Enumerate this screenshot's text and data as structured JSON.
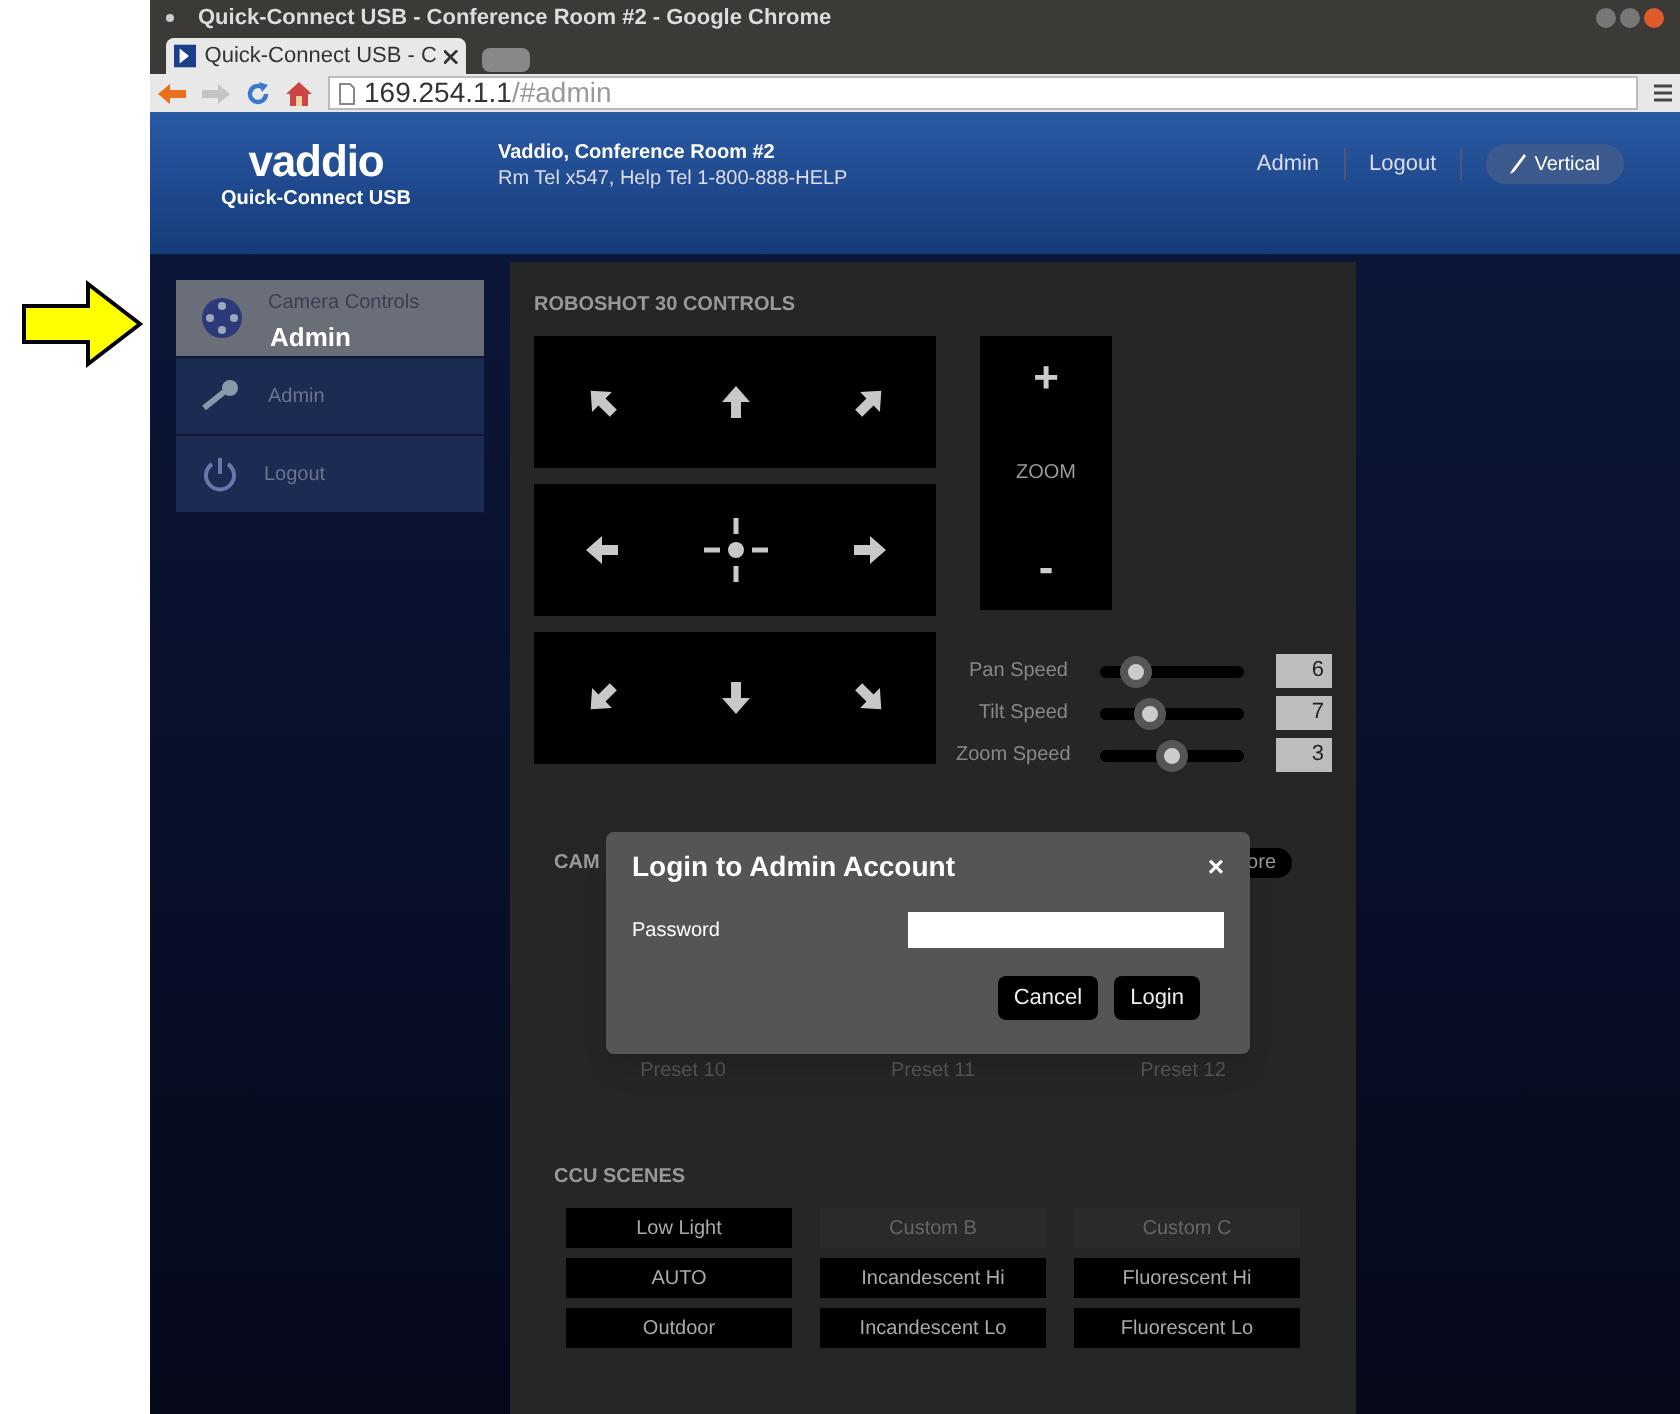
{
  "annotation": {
    "label": "Admin"
  },
  "window": {
    "title": "Quick-Connect USB - Conference Room #2 - Google Chrome"
  },
  "tabs": [
    {
      "label": "Quick-Connect USB - C",
      "selected": true
    }
  ],
  "address_bar": {
    "host": "169.254.1.1",
    "path": "/#admin"
  },
  "header": {
    "logo": "vaddio",
    "product": "Quick-Connect USB",
    "room": "Vaddio, Conference Room #2",
    "phone": "Rm Tel x547, Help Tel 1-800-888-HELP",
    "links": [
      "Admin",
      "Logout"
    ],
    "view_button": "Vertical"
  },
  "sidebar": {
    "items": [
      {
        "label": "Camera Controls",
        "selected": true
      },
      {
        "label": "Admin",
        "selected": false
      },
      {
        "label": "Logout",
        "selected": false
      }
    ]
  },
  "controls": {
    "title": "ROBOSHOT 30 CONTROLS",
    "zoom_label": "ZOOM",
    "zoom_in": "+",
    "zoom_out": "-",
    "speeds": [
      {
        "label": "Pan Speed",
        "level": 0.25,
        "value": "6"
      },
      {
        "label": "Tilt Speed",
        "level": 0.35,
        "value": "7"
      },
      {
        "label": "Zoom Speed",
        "level": 0.5,
        "value": "3"
      }
    ]
  },
  "presets": {
    "title": "CAM",
    "store": "ore",
    "buttons": [
      "Preset 10",
      "Preset 11",
      "Preset 12"
    ]
  },
  "dialog": {
    "title": "Login to Admin Account",
    "close": "×",
    "password_label": "Password",
    "buttons": [
      "Cancel",
      "Login"
    ]
  },
  "ccu_scenes": {
    "title": "CCU SCENES",
    "buttons": [
      {
        "label": "Low Light",
        "disabled": false
      },
      {
        "label": "Custom B",
        "disabled": true
      },
      {
        "label": "Custom C",
        "disabled": true
      },
      {
        "label": "AUTO",
        "disabled": false
      },
      {
        "label": "Incandescent Hi",
        "disabled": false
      },
      {
        "label": "Fluorescent Hi",
        "disabled": false
      },
      {
        "label": "Outdoor",
        "disabled": false
      },
      {
        "label": "Incandescent Lo",
        "disabled": false
      },
      {
        "label": "Fluorescent Lo",
        "disabled": false
      }
    ]
  }
}
